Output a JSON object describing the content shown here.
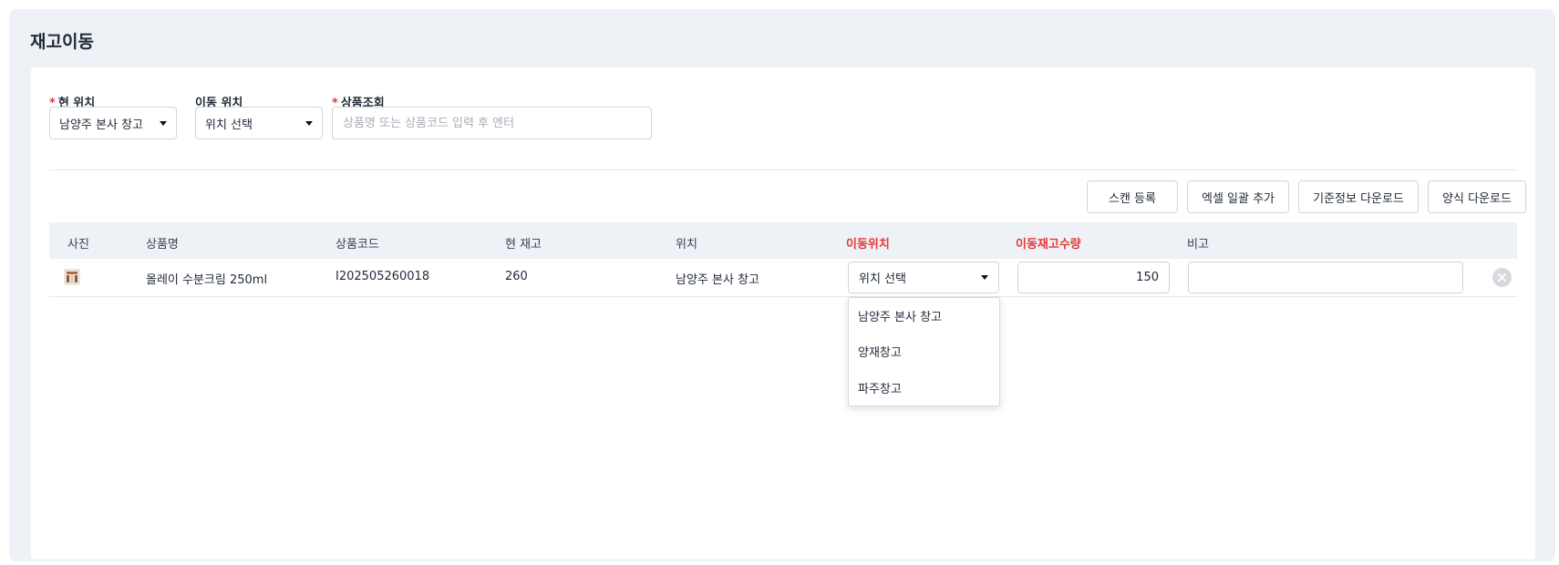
{
  "page": {
    "title": "재고이동"
  },
  "filters": {
    "current_location": {
      "label": "현 위치",
      "required": "*",
      "value": "남양주 본사 창고"
    },
    "move_location": {
      "label": "이동 위치",
      "value": "위치 선택"
    },
    "product_search": {
      "label": "상품조회",
      "required": "*",
      "placeholder": "상품명 또는 상품코드 입력 후 엔터"
    }
  },
  "toolbar": {
    "scan_register": "스캔 등록",
    "excel_bulk_add": "엑셀 일괄 추가",
    "master_download": "기준정보 다운로드",
    "template_download": "양식 다운로드"
  },
  "table": {
    "columns": [
      "사진",
      "상품명",
      "상품코드",
      "현 재고",
      "위치",
      "이동위치",
      "이동재고수량",
      "비고"
    ],
    "rows": [
      {
        "photo_icon": "product-thumbnail",
        "name": "올레이 수분크림 250ml",
        "code": "I202505260018",
        "stock": "260",
        "location": "남양주 본사 창고",
        "move_location": "위치 선택",
        "move_qty": "150",
        "note": ""
      }
    ]
  },
  "dropdown": {
    "options": [
      "남양주 본사 창고",
      "양재창고",
      "파주창고"
    ]
  },
  "colors": {
    "required": "#e53935",
    "header_bg": "#eef1f6",
    "highlight_column": "#e53935"
  }
}
